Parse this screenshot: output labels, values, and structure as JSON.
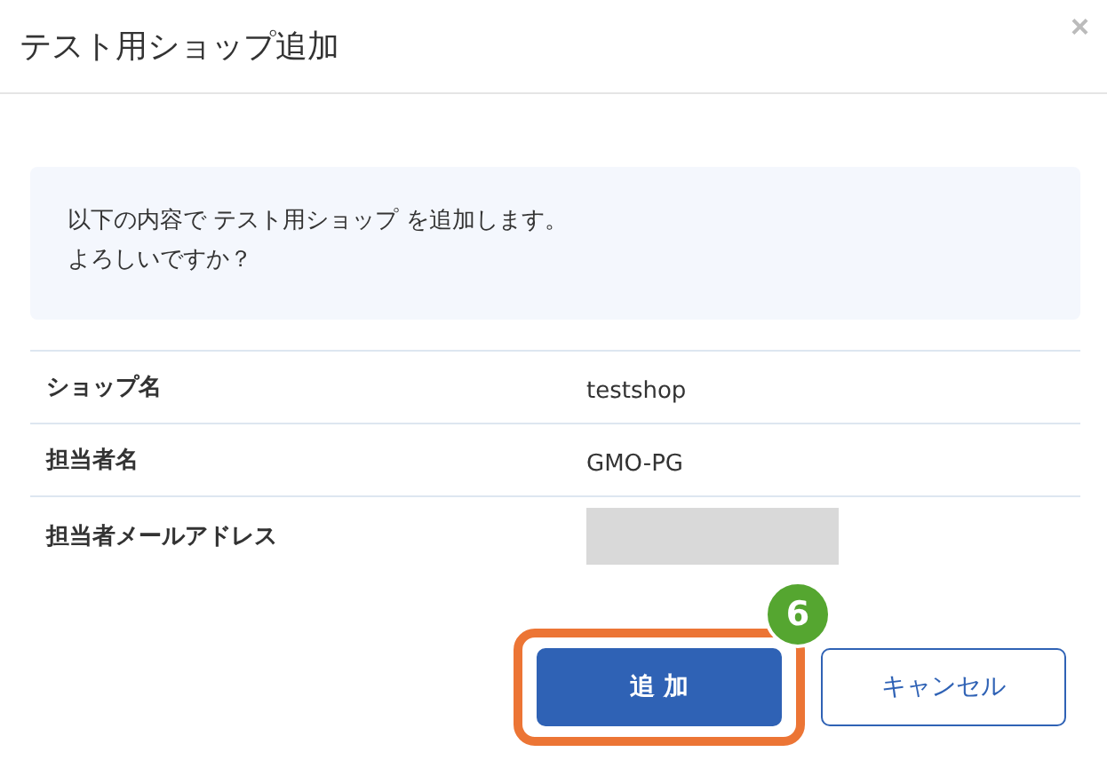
{
  "dialog": {
    "title": "テスト用ショップ追加",
    "close": "×"
  },
  "message": {
    "lines": [
      "以下の内容で テスト用ショップ を追加します。",
      "よろしいですか？"
    ]
  },
  "rows": [
    {
      "label": "ショップ名",
      "value": "testshop",
      "redacted": false
    },
    {
      "label": "担当者名",
      "value": "GMO-PG",
      "redacted": false
    },
    {
      "label": "担当者メールアドレス",
      "redacted": true
    }
  ],
  "buttons": [
    {
      "label": "追 加",
      "kind": "primary",
      "highlighted": true,
      "callout": "6"
    },
    {
      "label": "キャンセル",
      "kind": "secondary",
      "highlighted": false
    }
  ]
}
